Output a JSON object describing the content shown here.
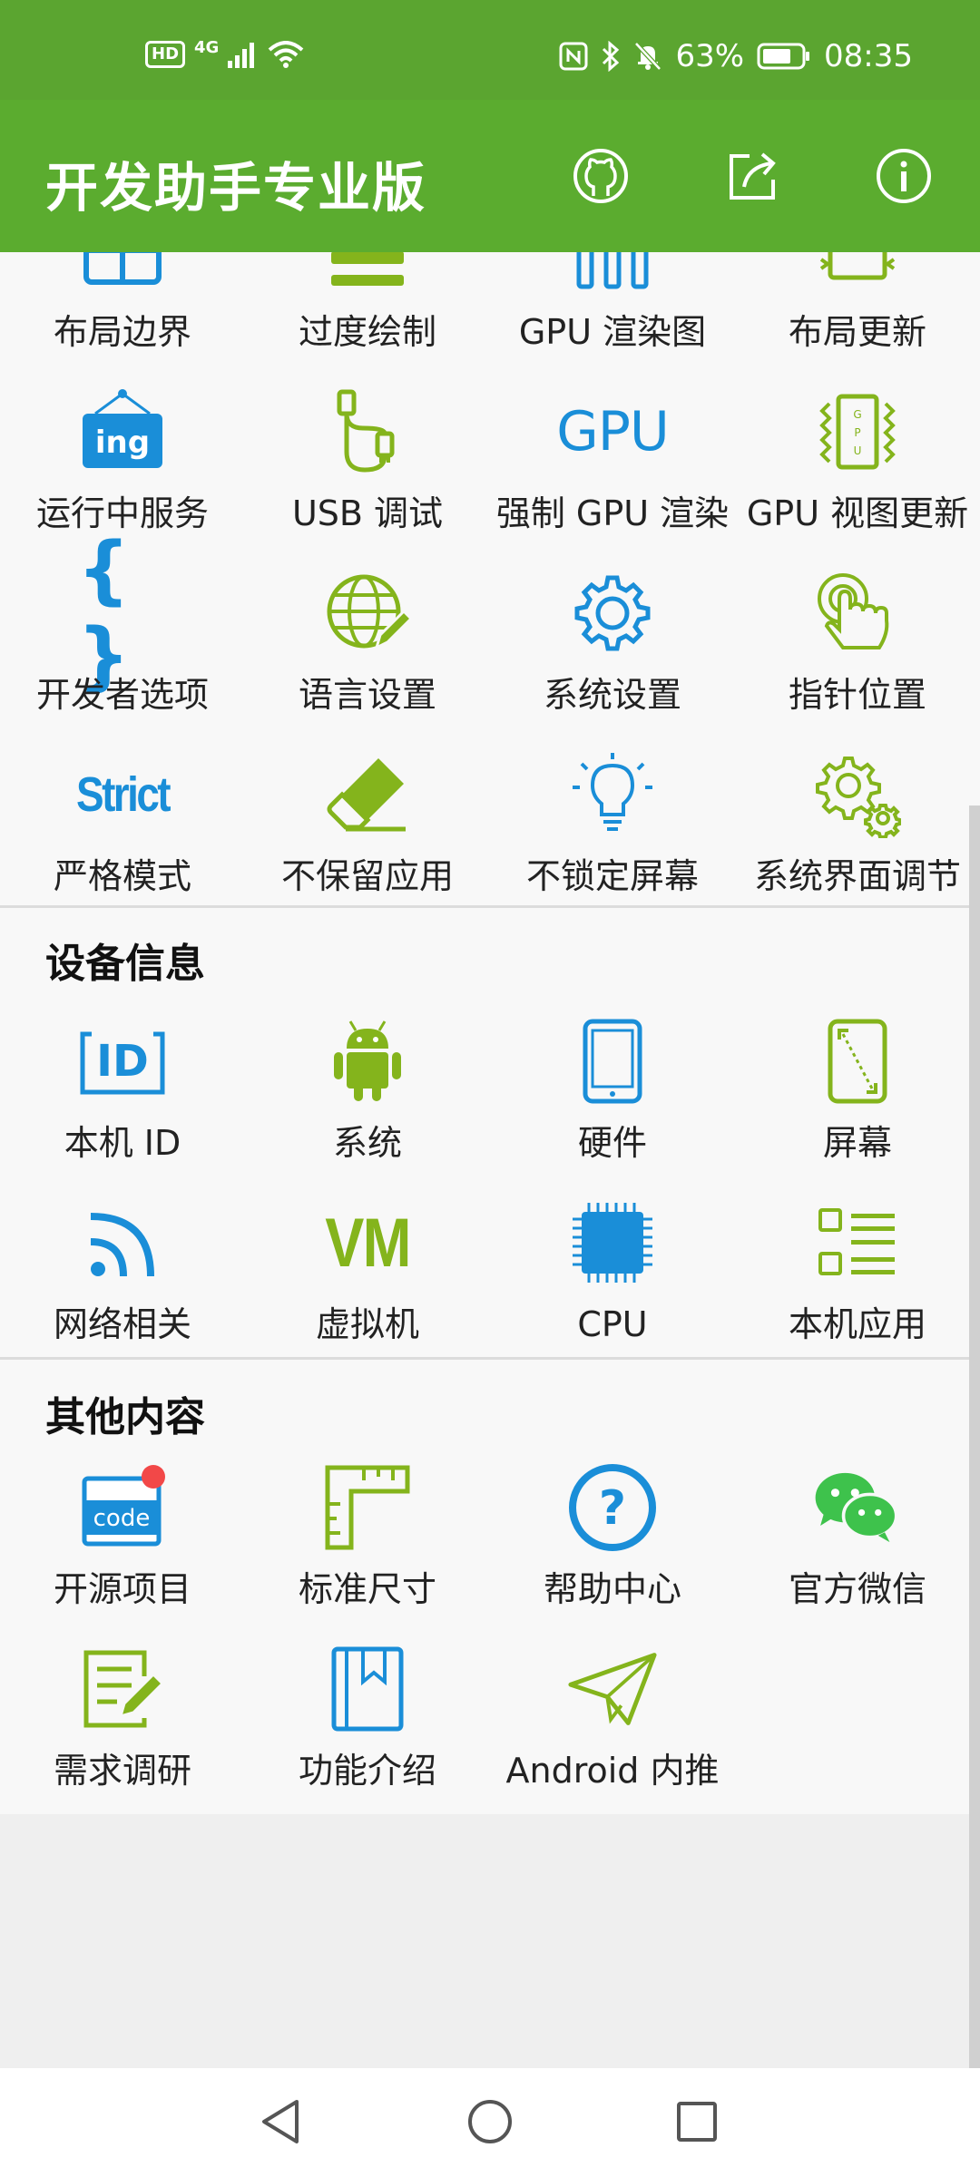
{
  "status": {
    "hd": "HD",
    "net": "4G",
    "battery": "63%",
    "time": "08:35"
  },
  "app": {
    "title": "开发助手专业版",
    "actions": [
      "github-icon",
      "share-icon",
      "info-icon"
    ]
  },
  "developer_options": {
    "items": [
      {
        "label": "布局边界",
        "icon": "layout-bounds-icon"
      },
      {
        "label": "过度绘制",
        "icon": "overdraw-icon"
      },
      {
        "label": "GPU 渲染图",
        "icon": "gpu-render-bars-icon"
      },
      {
        "label": "布局更新",
        "icon": "layout-update-icon"
      },
      {
        "label": "运行中服务",
        "icon": "running-services-icon",
        "icon_text": "ing"
      },
      {
        "label": "USB 调试",
        "icon": "usb-debug-icon"
      },
      {
        "label": "强制 GPU 渲染",
        "icon": "gpu-text-icon",
        "icon_text": "GPU"
      },
      {
        "label": "GPU 视图更新",
        "icon": "gpu-chip-icon"
      },
      {
        "label": "开发者选项",
        "icon": "braces-icon",
        "icon_text": "{ }"
      },
      {
        "label": "语言设置",
        "icon": "globe-pencil-icon"
      },
      {
        "label": "系统设置",
        "icon": "gear-icon"
      },
      {
        "label": "指针位置",
        "icon": "pointer-touch-icon"
      },
      {
        "label": "严格模式",
        "icon": "strict-icon",
        "icon_text": "Strict"
      },
      {
        "label": "不保留应用",
        "icon": "eraser-icon"
      },
      {
        "label": "不锁定屏幕",
        "icon": "lightbulb-icon"
      },
      {
        "label": "系统界面调节",
        "icon": "gears-icon"
      }
    ]
  },
  "device_info": {
    "title": "设备信息",
    "items": [
      {
        "label": "本机 ID",
        "icon": "id-icon",
        "icon_text": "ID"
      },
      {
        "label": "系统",
        "icon": "android-icon"
      },
      {
        "label": "硬件",
        "icon": "tablet-icon"
      },
      {
        "label": "屏幕",
        "icon": "screen-icon"
      },
      {
        "label": "网络相关",
        "icon": "wifi-rss-icon"
      },
      {
        "label": "虚拟机",
        "icon": "vm-icon",
        "icon_text": "VM"
      },
      {
        "label": "CPU",
        "icon": "cpu-chip-icon"
      },
      {
        "label": "本机应用",
        "icon": "app-list-icon"
      }
    ]
  },
  "other": {
    "title": "其他内容",
    "items": [
      {
        "label": "开源项目",
        "icon": "code-icon",
        "icon_text": "code"
      },
      {
        "label": "标准尺寸",
        "icon": "ruler-icon"
      },
      {
        "label": "帮助中心",
        "icon": "help-icon",
        "icon_text": "?"
      },
      {
        "label": "官方微信",
        "icon": "wechat-icon"
      },
      {
        "label": "需求调研",
        "icon": "survey-icon"
      },
      {
        "label": "功能介绍",
        "icon": "bookmark-book-icon"
      },
      {
        "label": "Android 内推",
        "icon": "paper-plane-icon"
      }
    ]
  },
  "colors": {
    "appbar": "#5bac2f",
    "blue": "#1a8ed8",
    "green": "#84b41c"
  }
}
